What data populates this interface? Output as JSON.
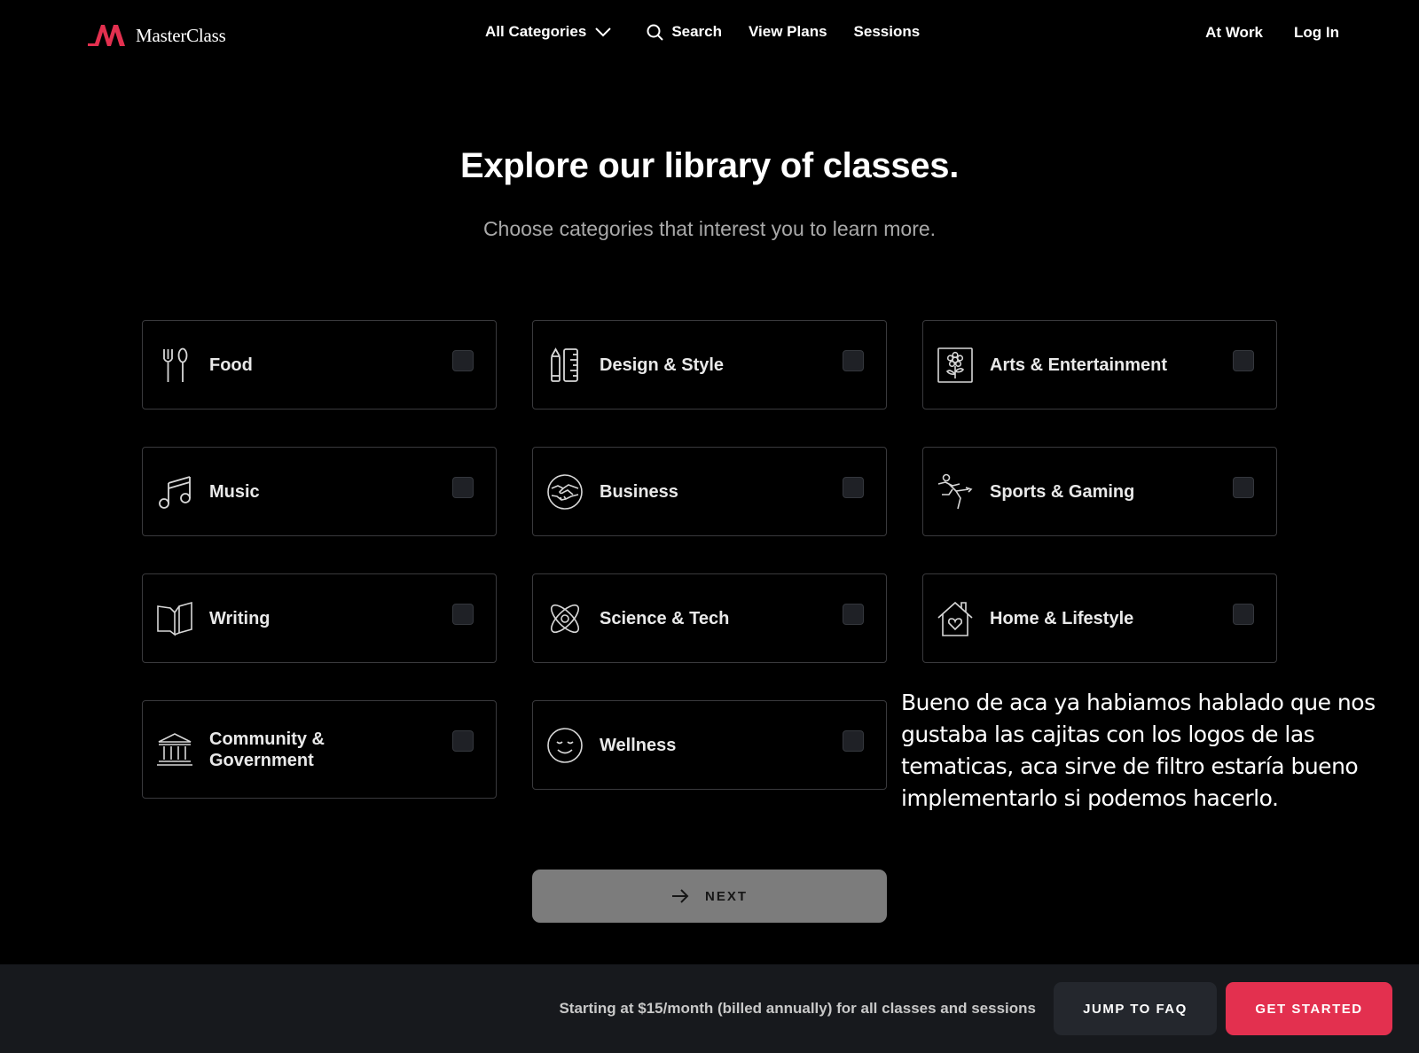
{
  "nav": {
    "brand": "MasterClass",
    "all_categories": "All Categories",
    "search": "Search",
    "view_plans": "View Plans",
    "sessions": "Sessions",
    "at_work": "At Work",
    "log_in": "Log In"
  },
  "hero": {
    "title": "Explore our library of classes.",
    "subtitle": "Choose categories that interest you to learn more."
  },
  "categories": [
    {
      "label": "Food",
      "icon": "fork-spoon-icon",
      "checked": false
    },
    {
      "label": "Design & Style",
      "icon": "pencil-ruler-icon",
      "checked": false
    },
    {
      "label": "Arts & Entertainment",
      "icon": "flower-frame-icon",
      "checked": false
    },
    {
      "label": "Music",
      "icon": "music-note-icon",
      "checked": false
    },
    {
      "label": "Business",
      "icon": "handshake-icon",
      "checked": false
    },
    {
      "label": "Sports & Gaming",
      "icon": "athlete-icon",
      "checked": false
    },
    {
      "label": "Writing",
      "icon": "open-book-icon",
      "checked": false
    },
    {
      "label": "Science & Tech",
      "icon": "atom-icon",
      "checked": false
    },
    {
      "label": "Home & Lifestyle",
      "icon": "house-heart-icon",
      "checked": false
    },
    {
      "label": "Community & Government",
      "icon": "government-building-icon",
      "checked": false
    },
    {
      "label": "Wellness",
      "icon": "smiley-face-icon",
      "checked": false
    }
  ],
  "annotation": "Bueno de aca ya habiamos hablado que nos gustaba las cajitas con los logos de las tematicas, aca sirve de filtro estaría bueno implementarlo si podemos hacerlo.",
  "next_button": "NEXT",
  "footer": {
    "pricing_text": "Starting at $15/month (billed annually) for all classes and sessions",
    "faq_button": "JUMP TO FAQ",
    "get_started_button": "GET STARTED"
  },
  "colors": {
    "background": "#000000",
    "accent": "#e3304f",
    "card_border": "#3a3a3d",
    "footer_bg": "#17191d",
    "next_button_bg": "#7c7c7c"
  }
}
